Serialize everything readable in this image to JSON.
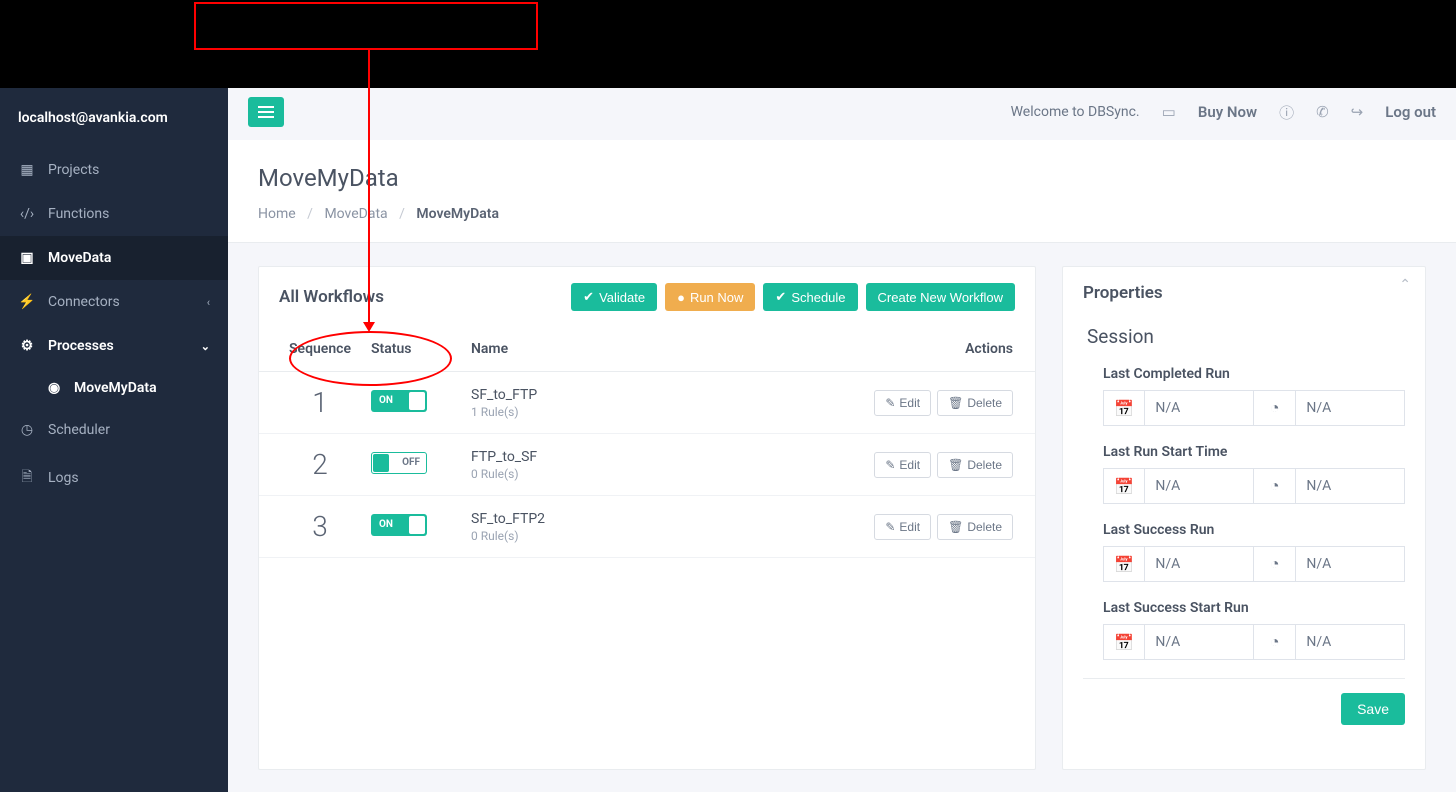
{
  "user_email": "localhost@avankia.com",
  "sidebar": {
    "items": [
      {
        "label": "Projects"
      },
      {
        "label": "Functions"
      },
      {
        "label": "MoveData"
      },
      {
        "label": "Connectors"
      },
      {
        "label": "Processes",
        "sub": [
          {
            "label": "MoveMyData"
          }
        ]
      },
      {
        "label": "Scheduler"
      },
      {
        "label": "Logs"
      }
    ]
  },
  "topbar": {
    "welcome": "Welcome to DBSync.",
    "buy_now": "Buy Now",
    "logout": "Log out"
  },
  "page": {
    "title": "MoveMyData",
    "breadcrumb": {
      "home": "Home",
      "p1": "MoveData",
      "current": "MoveMyData"
    }
  },
  "workflows": {
    "title": "All Workflows",
    "buttons": {
      "validate": "Validate",
      "run_now": "Run Now",
      "schedule": "Schedule",
      "create": "Create New Workflow"
    },
    "columns": {
      "sequence": "Sequence",
      "status": "Status",
      "name": "Name",
      "actions": "Actions"
    },
    "toggle_on": "ON",
    "toggle_off": "OFF",
    "edit_label": "Edit",
    "delete_label": "Delete",
    "rows": [
      {
        "seq": "1",
        "on": true,
        "name": "SF_to_FTP",
        "rules": "1 Rule(s)"
      },
      {
        "seq": "2",
        "on": false,
        "name": "FTP_to_SF",
        "rules": "0 Rule(s)"
      },
      {
        "seq": "3",
        "on": true,
        "name": "SF_to_FTP2",
        "rules": "0 Rule(s)"
      }
    ]
  },
  "properties": {
    "title": "Properties",
    "session": "Session",
    "fields": [
      {
        "label": "Last Completed Run",
        "date": "N/A",
        "time": "N/A"
      },
      {
        "label": "Last Run Start Time",
        "date": "N/A",
        "time": "N/A"
      },
      {
        "label": "Last Success Run",
        "date": "N/A",
        "time": "N/A"
      },
      {
        "label": "Last Success Start Run",
        "date": "N/A",
        "time": "N/A"
      }
    ],
    "save": "Save"
  }
}
